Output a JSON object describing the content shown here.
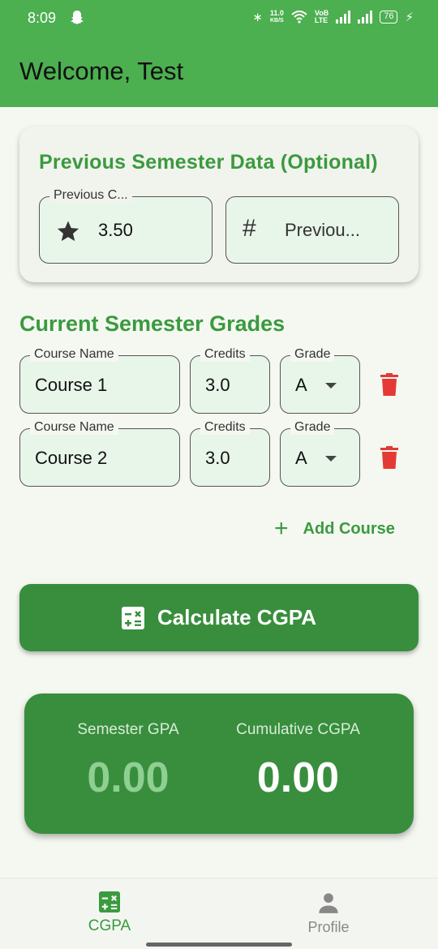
{
  "status_bar": {
    "time": "8:09",
    "speed_value": "11.0",
    "speed_unit": "KB/S",
    "volte_top": "VoB",
    "volte_bottom": "LTE",
    "battery": "76"
  },
  "app_bar": {
    "title": "Welcome, Test"
  },
  "previous_semester": {
    "title": "Previous Semester Data (Optional)",
    "cgpa_field": {
      "label": "Previous C...",
      "value": "3.50",
      "icon": "star-icon"
    },
    "credits_field": {
      "placeholder": "Previou...",
      "icon": "hash-icon"
    }
  },
  "current_semester": {
    "title": "Current Semester Grades",
    "labels": {
      "course": "Course Name",
      "credits": "Credits",
      "grade": "Grade"
    },
    "courses": [
      {
        "name": "Course 1",
        "credits": "3.0",
        "grade": "A"
      },
      {
        "name": "Course 2",
        "credits": "3.0",
        "grade": "A"
      }
    ],
    "add_course_label": "Add Course"
  },
  "calculate_button": {
    "label": "Calculate CGPA",
    "icon": "calculator-icon"
  },
  "results": {
    "semester_gpa_label": "Semester GPA",
    "semester_gpa_value": "0.00",
    "cumulative_cgpa_label": "Cumulative CGPA",
    "cumulative_cgpa_value": "0.00"
  },
  "bottom_nav": {
    "items": [
      {
        "label": "CGPA",
        "icon": "calculator-icon",
        "active": true
      },
      {
        "label": "Profile",
        "icon": "person-icon",
        "active": false
      }
    ]
  },
  "colors": {
    "primary": "#4caf50",
    "primary_dark": "#388e3c",
    "accent_text": "#3a9a3f",
    "delete": "#e53935",
    "field_fill": "#e8f5e9",
    "faded_value": "#8fcf92"
  }
}
